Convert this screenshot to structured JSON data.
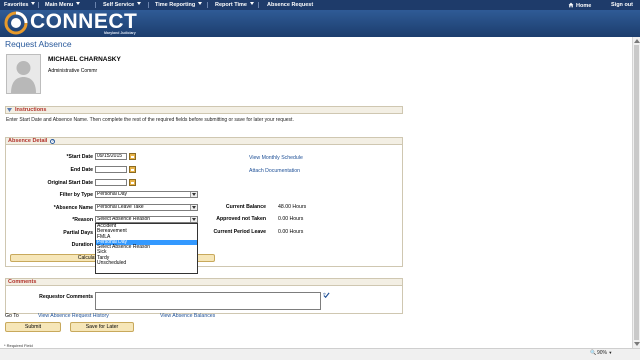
{
  "nav": {
    "favorites": "Favorites",
    "main_menu": "Main Menu",
    "self_service": "Self Service",
    "time_reporting": "Time Reporting",
    "report_time": "Report Time",
    "absence_request": "Absence Request",
    "home": "Home",
    "sign_out": "Sign out"
  },
  "brand": {
    "name": "CONNECT",
    "subtitle": "Maryland Judiciary"
  },
  "page": {
    "title": "Request Absence"
  },
  "employee": {
    "name": "MICHAEL CHARNASKY",
    "title": "Administrative Commr"
  },
  "instructions": {
    "header": "Instructions",
    "text": "Enter Start Date and Absence Name. Then complete the rest of the required fields before submitting or save for later your request."
  },
  "absence_detail": {
    "header": "Absence Detail",
    "labels": {
      "start_date": "*Start Date",
      "end_date": "End Date",
      "original_start_date": "Original Start Date",
      "filter_by_type": "Filter by Type",
      "absence_name": "*Absence Name",
      "reason": "*Reason",
      "partial_days": "Partial Days",
      "duration": "Duration"
    },
    "values": {
      "start_date": "09/15/2015",
      "end_date": "",
      "original_start_date": "",
      "filter_by_type": "Personal Day",
      "absence_name": "Personal Leave Take",
      "reason": "Select Absence Reason"
    },
    "reason_options": [
      "Accident",
      "Bereavement",
      "FMLA",
      "Personal Day",
      "Select Absence Reason",
      "Sick",
      "Tardy",
      "Unscheduled"
    ],
    "reason_highlighted": "Personal Day",
    "links": {
      "monthly_schedule": "View Monthly Schedule",
      "attach_doc": "Attach Documentation"
    },
    "balances": {
      "current_balance_label": "Current Balance",
      "current_balance_value": "48.00 Hours",
      "approved_not_taken_label": "Approved not Taken",
      "approved_not_taken_value": "0.00 Hours",
      "current_period_leave_label": "Current Period Leave",
      "current_period_leave_value": "0.00 Hours"
    },
    "calc_button": "Calculate End Date or Duration"
  },
  "comments": {
    "header": "Comments",
    "requestor_label": "Requestor Comments"
  },
  "goto": {
    "label": "Go To",
    "history": "View Absence Request History",
    "balances": "View Absence Balances"
  },
  "actions": {
    "submit": "Submit",
    "save_for_later": "Save for Later"
  },
  "footer": {
    "required_note": "* Required Field",
    "zoom": "90%"
  }
}
